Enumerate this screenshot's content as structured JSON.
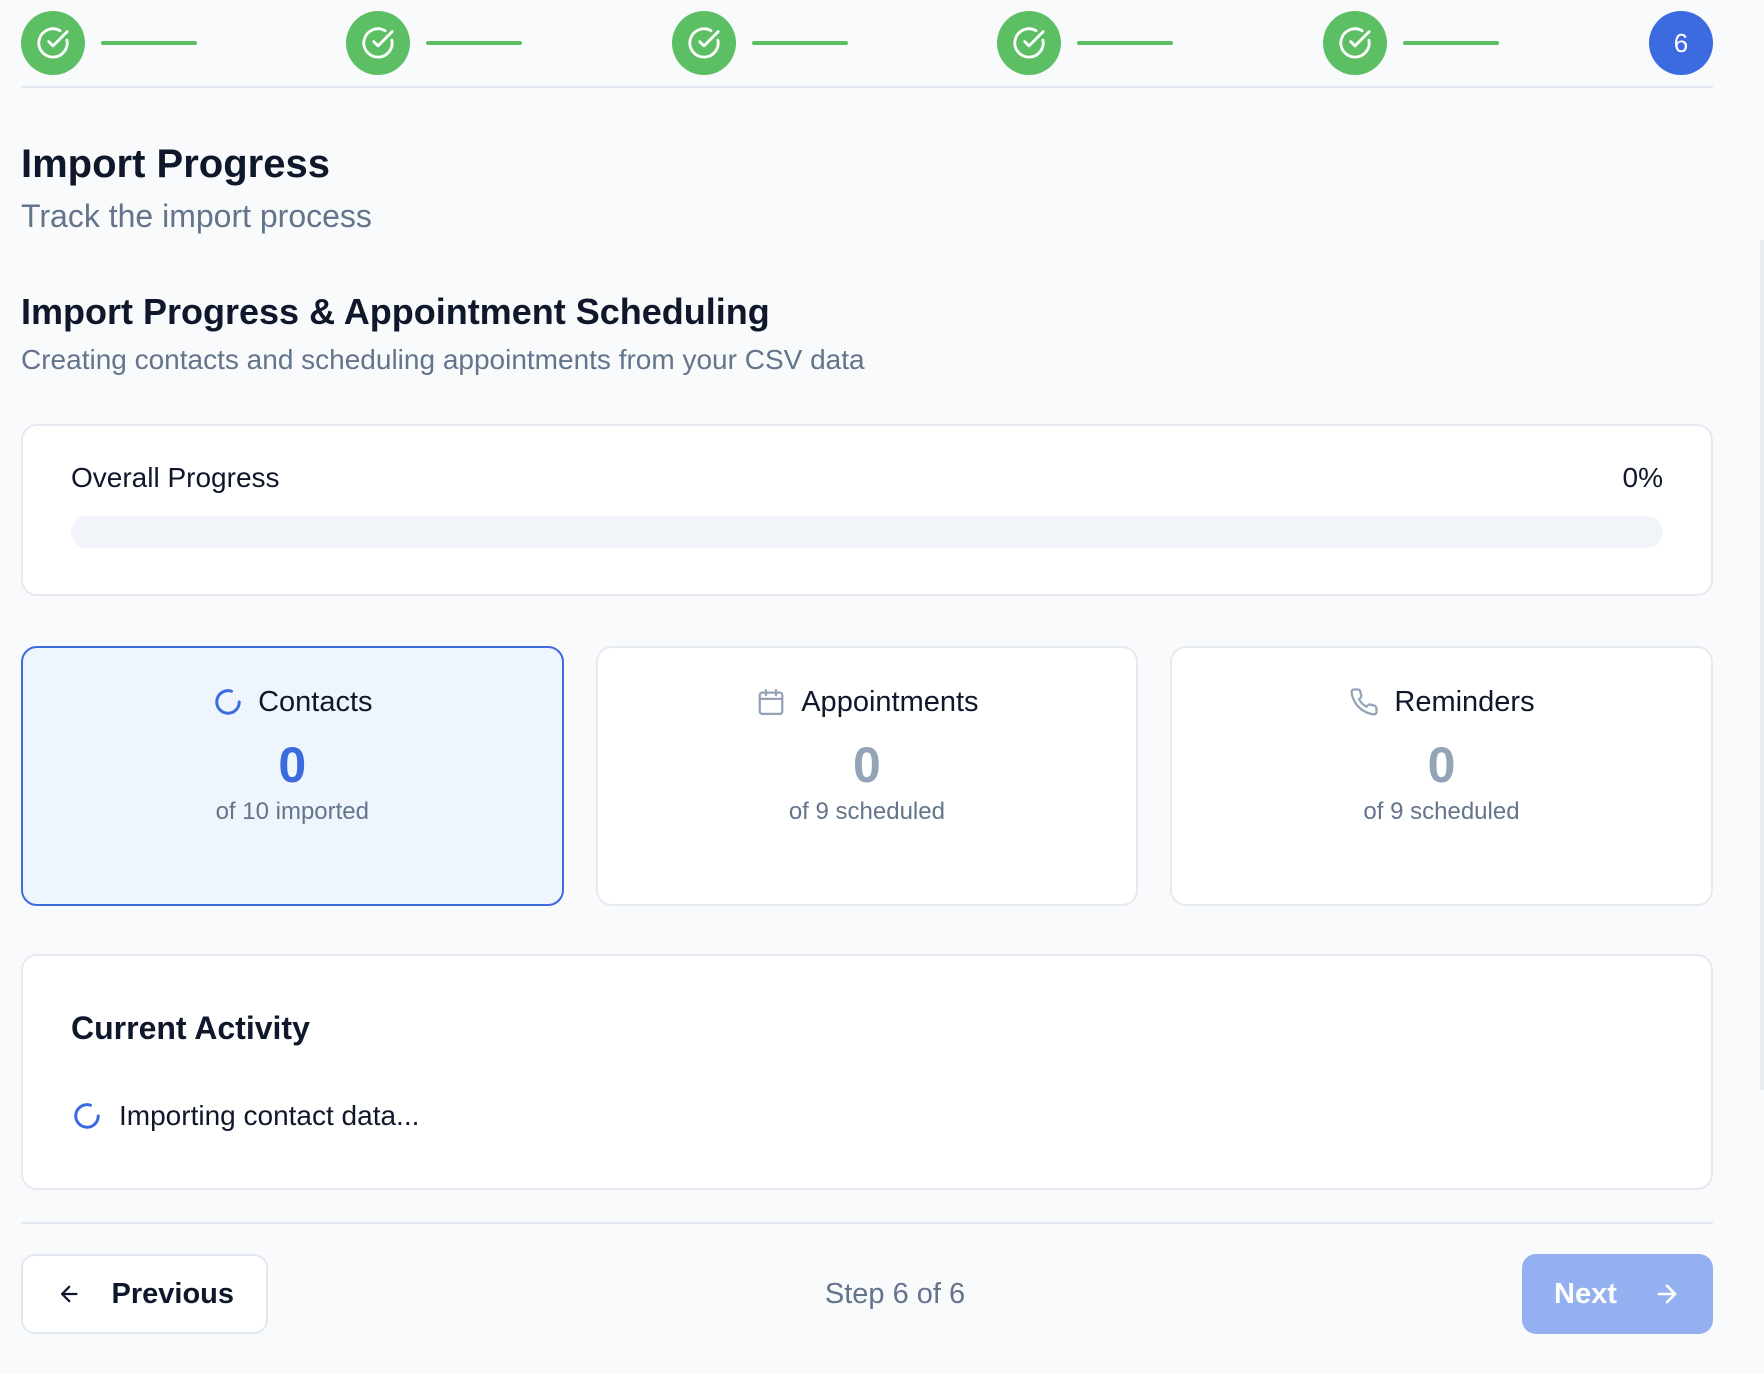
{
  "stepper": {
    "steps": [
      {
        "state": "complete",
        "icon": "check-circle-icon"
      },
      {
        "state": "complete",
        "icon": "check-circle-icon"
      },
      {
        "state": "complete",
        "icon": "check-circle-icon"
      },
      {
        "state": "complete",
        "icon": "check-circle-icon"
      },
      {
        "state": "complete",
        "icon": "check-circle-icon"
      },
      {
        "state": "current",
        "label": "6"
      }
    ],
    "colors": {
      "complete": "#5cbf63",
      "current": "#3c6be0"
    }
  },
  "header": {
    "title": "Import Progress",
    "subtitle": "Track the import process"
  },
  "section": {
    "title": "Import Progress & Appointment Scheduling",
    "subtitle": "Creating contacts and scheduling appointments from your CSV data"
  },
  "overall": {
    "label": "Overall Progress",
    "percent_label": "0%",
    "progress_fraction": 0
  },
  "stats": {
    "contacts": {
      "label": "Contacts",
      "value": "0",
      "caption": "of 10 imported",
      "icon": "loading-spinner-icon",
      "active": true
    },
    "appointments": {
      "label": "Appointments",
      "value": "0",
      "caption": "of 9 scheduled",
      "icon": "calendar-icon",
      "active": false
    },
    "reminders": {
      "label": "Reminders",
      "value": "0",
      "caption": "of 9 scheduled",
      "icon": "phone-icon",
      "active": false
    }
  },
  "activity": {
    "title": "Current Activity",
    "status": "Importing contact data...",
    "icon": "loading-spinner-icon"
  },
  "footer": {
    "previous_label": "Previous",
    "step_indicator": "Step 6 of 6",
    "next_label": "Next",
    "next_enabled": false
  },
  "colors": {
    "accent": "#3c6be0",
    "success": "#5cbf63",
    "muted_text": "#64748b",
    "next_disabled_bg": "#93b0f0"
  }
}
